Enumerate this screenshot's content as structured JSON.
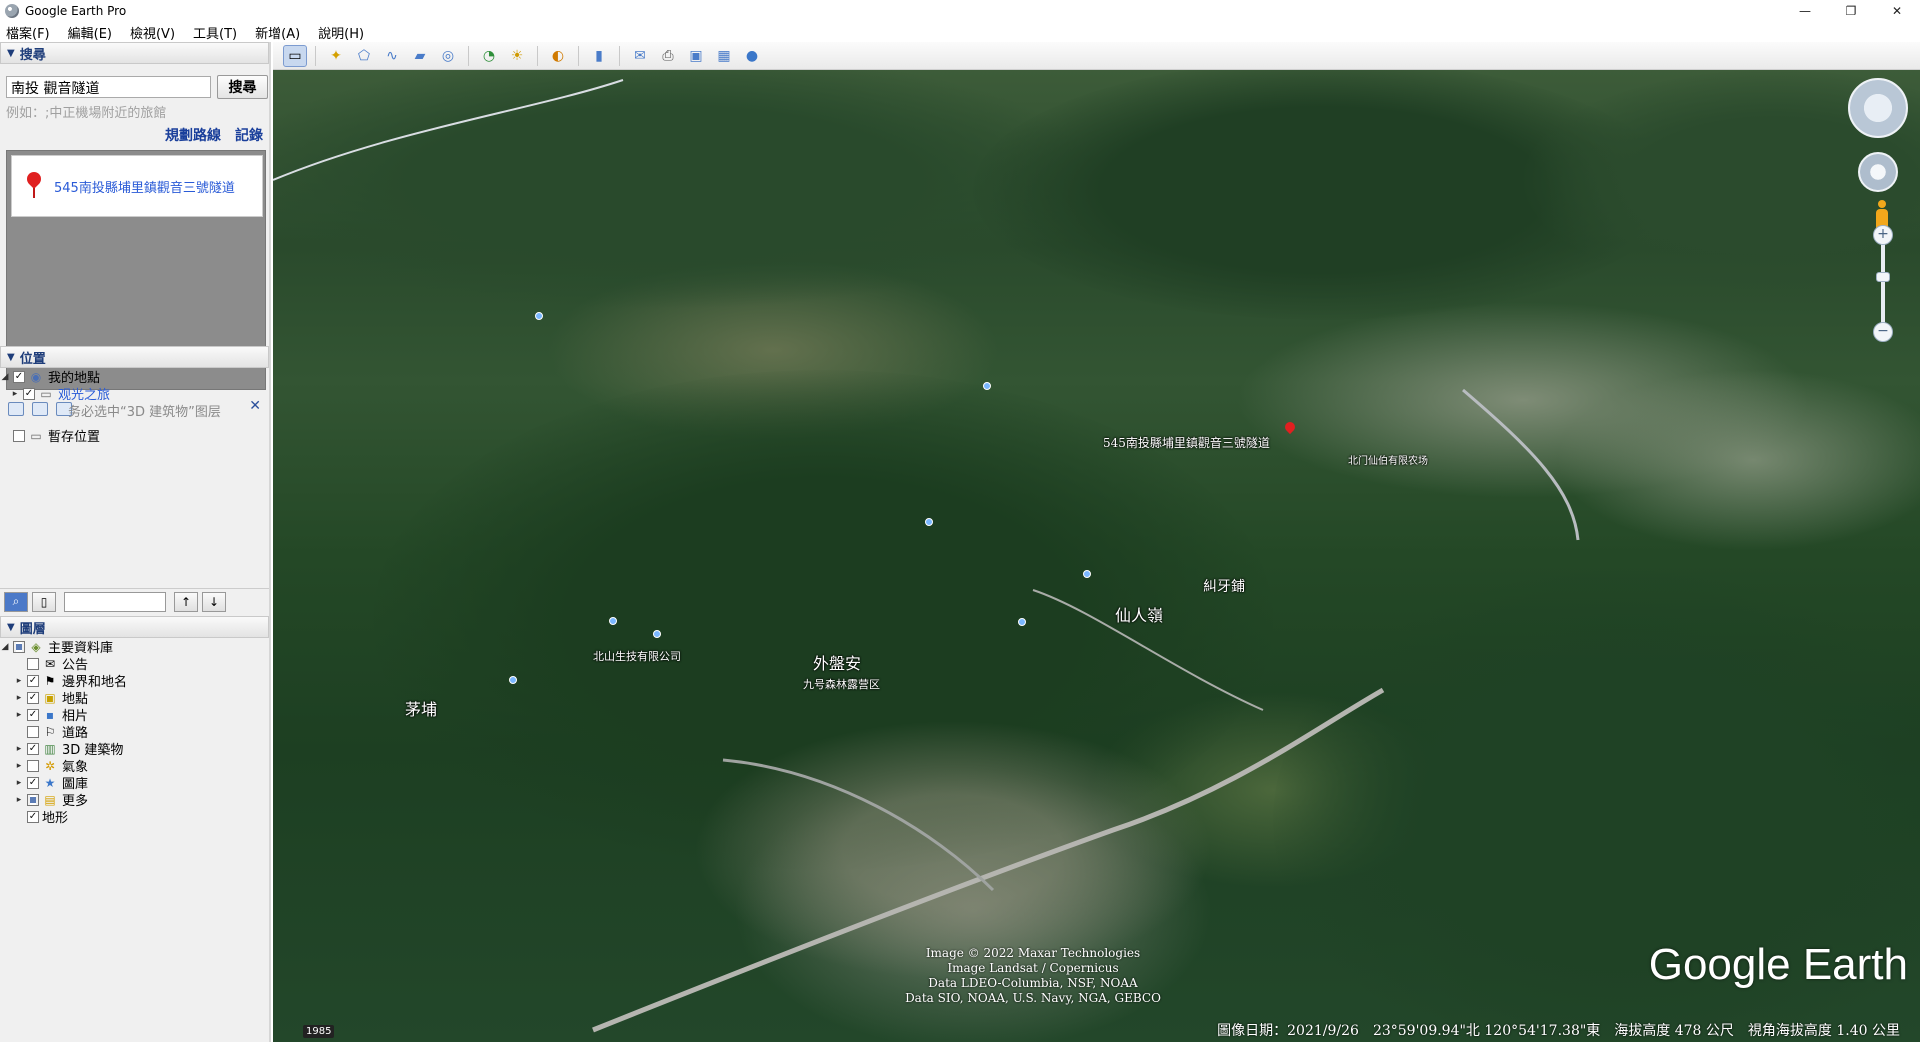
{
  "window": {
    "title": "Google Earth Pro",
    "minimize": "—",
    "restore": "❐",
    "close": "✕"
  },
  "menu": [
    "檔案(F)",
    "編輯(E)",
    "檢視(V)",
    "工具(T)",
    "新增(A)",
    "說明(H)"
  ],
  "search_panel": {
    "header": "搜尋",
    "query": "南投 觀音隧道",
    "button": "搜尋",
    "hint": "例如：;中正機場附近的旅館",
    "link_route": "規劃路線",
    "link_history": "記錄",
    "result": "545南投縣埔里鎮觀音三號隧道"
  },
  "places_panel": {
    "header": "位置",
    "items": [
      {
        "label": "我的地點",
        "checked": true
      },
      {
        "label": "观光之旅",
        "checked": true
      },
      {
        "label": "务必选中“3D 建筑物”图层",
        "note": true
      },
      {
        "label": "暫存位置",
        "checked": false
      }
    ]
  },
  "layers_panel": {
    "header": "圖層",
    "items": [
      {
        "label": "主要資料庫",
        "icon": "layers-icon"
      },
      {
        "label": "公告",
        "icon": "mail-icon",
        "checked": false
      },
      {
        "label": "邊界和地名",
        "icon": "flag-icon",
        "checked": true
      },
      {
        "label": "地點",
        "icon": "place-icon",
        "checked": true
      },
      {
        "label": "相片",
        "icon": "photo-icon",
        "checked": true
      },
      {
        "label": "道路",
        "icon": "road-icon",
        "checked": false
      },
      {
        "label": "3D 建築物",
        "icon": "building-icon",
        "checked": true
      },
      {
        "label": "氣象",
        "icon": "weather-icon",
        "checked": false
      },
      {
        "label": "圖庫",
        "icon": "gallery-icon",
        "checked": true
      },
      {
        "label": "更多",
        "icon": "more-icon",
        "checked": false
      },
      {
        "label": "地形",
        "icon": "terrain-icon",
        "checked": true
      }
    ]
  },
  "map": {
    "placemark_label": "545南投縣埔里鎮觀音三號隧道",
    "labels": [
      "仙人嶺",
      "糾牙鋪",
      "外盤安",
      "茅埔",
      "北山生技有限公司",
      "九号森林露营区",
      "北门仙伯有限农场"
    ],
    "attribution": [
      "Image © 2022 Maxar Technologies",
      "Image Landsat / Copernicus",
      "Data LDEO-Columbia, NSF, NOAA",
      "Data SIO, NOAA, U.S. Navy, NGA, GEBCO"
    ],
    "logo": "Google Earth",
    "year": "1985",
    "status": {
      "imagery_date": "圖像日期：2021/9/26",
      "coords": "23°59'09.94\"北 120°54'17.38\"東",
      "elevation": "海拔高度  478 公尺",
      "eye_alt": "視角海拔高度  1.40 公里"
    }
  }
}
